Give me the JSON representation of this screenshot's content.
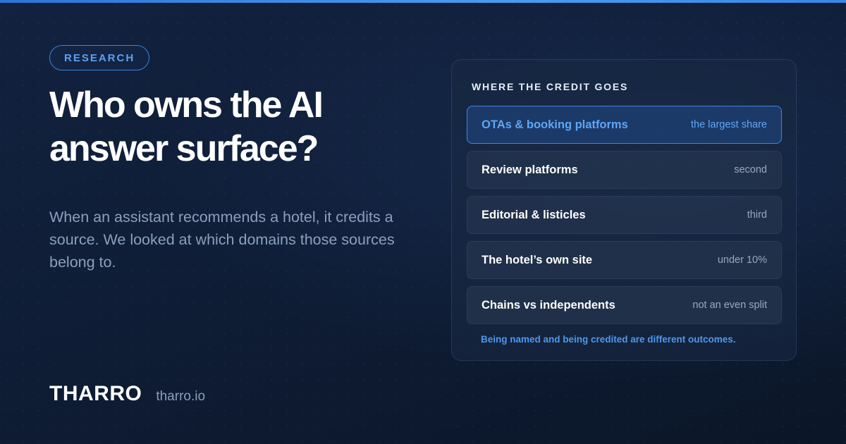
{
  "colors": {
    "accent": "#4d9bf0",
    "background": "#0f1d36",
    "headline": "#ffffff",
    "muted_text": "#8aa0bd"
  },
  "badge": {
    "label": "RESEARCH"
  },
  "headline": "Who owns the AI answer surface?",
  "lede": "When an assistant recommends a hotel, it credits a source. We looked at which domains those sources belong to.",
  "brand": {
    "name": "THARRO",
    "url": "tharro.io"
  },
  "panel": {
    "title": "WHERE THE CREDIT GOES",
    "rows": [
      {
        "label": "OTAs & booking platforms",
        "value": "the largest share",
        "highlighted": true
      },
      {
        "label": "Review platforms",
        "value": "second",
        "highlighted": false
      },
      {
        "label": "Editorial & listicles",
        "value": "third",
        "highlighted": false
      },
      {
        "label": "The hotel’s own site",
        "value": "under 10%",
        "highlighted": false
      },
      {
        "label": "Chains vs independents",
        "value": "not an even split",
        "highlighted": false
      }
    ],
    "footnote": "Being named and being credited are different outcomes."
  }
}
